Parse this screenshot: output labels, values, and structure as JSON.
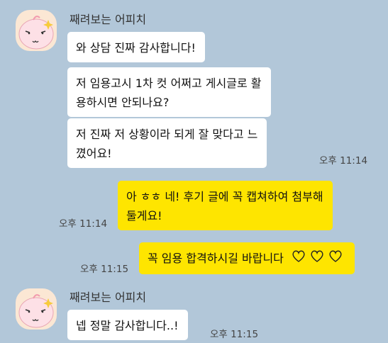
{
  "sender_name": "째려보는 어피치",
  "messages": [
    {
      "side": "in",
      "text": "와 상담 진짜 감사합니다!"
    },
    {
      "side": "in",
      "lines": [
        "저 임용고시 1차 컷 어쩌고 게시글로 활",
        "용하시면 안되나요?"
      ]
    },
    {
      "side": "in",
      "lines": [
        "저 진짜 저 상황이라 되게 잘 맞다고 느",
        "꼈어요!"
      ],
      "time": "오후 11:14"
    },
    {
      "side": "out",
      "lines": [
        "아 ㅎㅎ 네! 후기 글에 꼭 캡쳐하여 첨부해",
        "둘게요!"
      ],
      "time": "오후 11:14"
    },
    {
      "side": "out",
      "text": "꼭 임용 합격하시길 바랍니다",
      "emoji": "heart-icons",
      "time": "오후 11:15"
    },
    {
      "side": "in",
      "text": "넵 정말 감사합니다..!",
      "time": "오후 11:15"
    }
  ],
  "colors": {
    "background": "#b2c7d9",
    "incoming_bubble": "#ffffff",
    "outgoing_bubble": "#fee500"
  }
}
